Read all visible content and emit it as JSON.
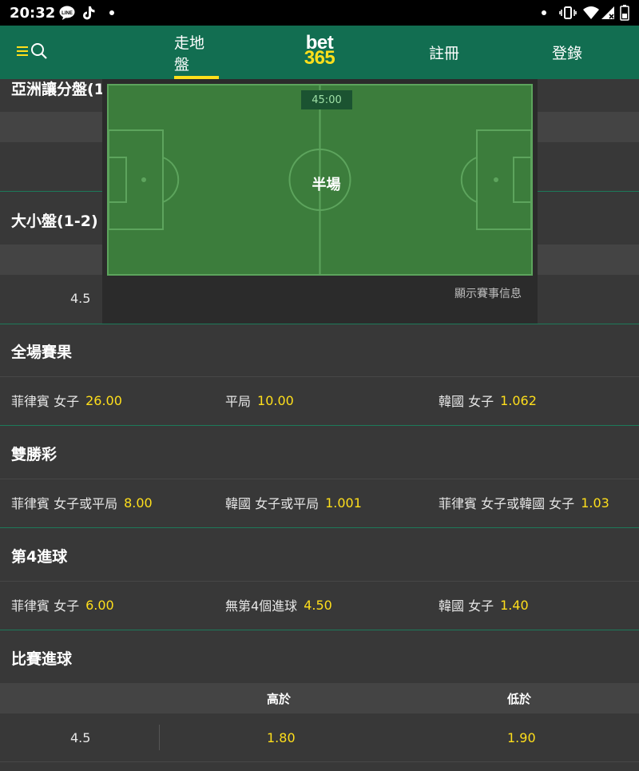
{
  "status_bar": {
    "time": "20:32",
    "left_icons": [
      "line-app-icon",
      "tiktok-icon",
      "notification-dot-icon"
    ],
    "right_icons": [
      "notification-dot-icon",
      "vibrate-icon",
      "wifi-icon",
      "signal-no-data-icon",
      "battery-icon"
    ]
  },
  "header": {
    "nav": {
      "in_play": "走地盤",
      "register": "註冊",
      "login": "登錄"
    },
    "logo": {
      "line1": "bet",
      "line2": "365"
    },
    "colors": {
      "header_bg": "#126e51",
      "accent": "#ffdf1b"
    }
  },
  "background": {
    "asian_handicap_title": "亞洲讓分盤(1",
    "over_under_title": "大小盤(1-2)",
    "over_under_line": "4.5"
  },
  "overlay": {
    "clock": "45:00",
    "status": "半場",
    "show_info": "顯示賽事信息"
  },
  "markets": {
    "full_time": {
      "title": "全場賽果",
      "selections": [
        {
          "name": "菲律賓 女子",
          "price": "26.00"
        },
        {
          "name": "平局",
          "price": "10.00"
        },
        {
          "name": "韓國 女子",
          "price": "1.062"
        }
      ]
    },
    "double_chance": {
      "title": "雙勝彩",
      "selections": [
        {
          "name": "菲律賓 女子或平局",
          "price": "8.00"
        },
        {
          "name": "韓國 女子或平局",
          "price": "1.001"
        },
        {
          "name": "菲律賓 女子或韓國 女子",
          "price": "1.03"
        }
      ]
    },
    "fourth_goal": {
      "title": "第4進球",
      "selections": [
        {
          "name": "菲律賓 女子",
          "price": "6.00"
        },
        {
          "name": "無第4個進球",
          "price": "4.50"
        },
        {
          "name": "韓國 女子",
          "price": "1.40"
        }
      ]
    },
    "match_goals": {
      "title": "比賽進球",
      "columns": {
        "over": "高於",
        "under": "低於"
      },
      "line": "4.5",
      "over_price": "1.80",
      "under_price": "1.90"
    }
  }
}
